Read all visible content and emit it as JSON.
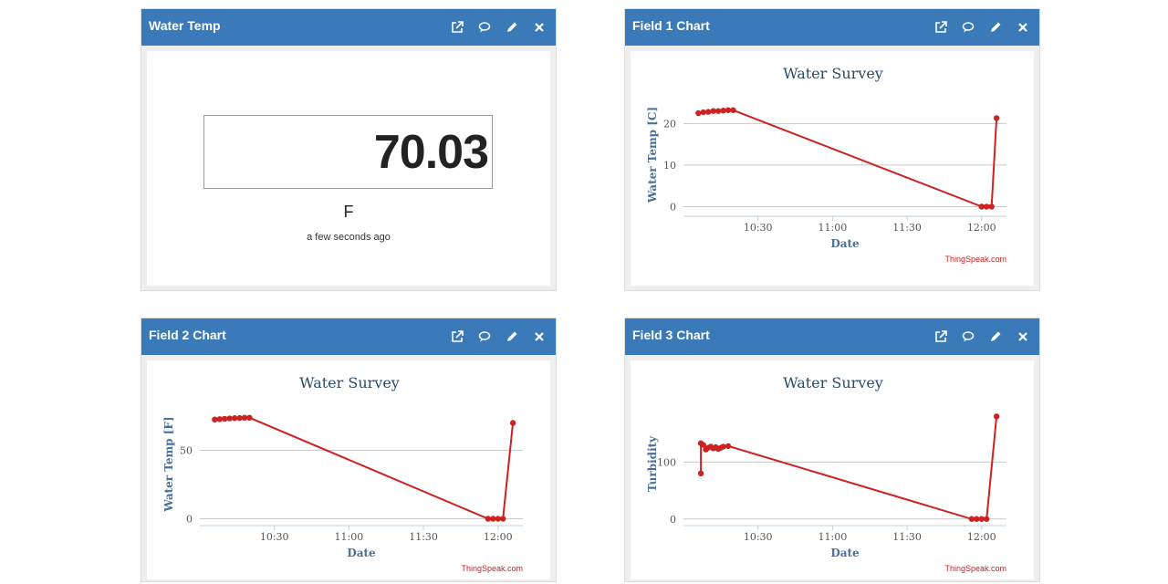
{
  "panels": [
    {
      "title": "Water Temp"
    },
    {
      "title": "Field 1 Chart"
    },
    {
      "title": "Field 2 Chart"
    },
    {
      "title": "Field 3 Chart"
    }
  ],
  "readout": {
    "value": "70.03",
    "unit": "F",
    "updated": "a few seconds ago"
  },
  "chart_credit": "ThingSpeak.com",
  "colors": {
    "header": "#3a7ab8",
    "series": "#cc2222",
    "title": "#2b4a6a",
    "axis_title": "#4a6f98"
  },
  "icons": [
    "external-link-icon",
    "comment-icon",
    "pencil-icon",
    "close-icon"
  ],
  "chart_data": [
    {
      "type": "line",
      "title": "Water Survey",
      "xlabel": "Date",
      "ylabel": "Water Temp [C]",
      "x_ticks": [
        "10:30",
        "11:00",
        "11:30",
        "12:00"
      ],
      "y_ticks": [
        0,
        10,
        20
      ],
      "ylim": [
        -1,
        26
      ],
      "series": [
        {
          "x": [
            "10:06",
            "10:08",
            "10:10",
            "10:12",
            "10:14",
            "10:16",
            "10:18",
            "10:20",
            "12:00",
            "12:02",
            "12:04",
            "12:06"
          ],
          "values": [
            22.5,
            22.7,
            22.8,
            23.0,
            23.0,
            23.1,
            23.2,
            23.2,
            0,
            0,
            0,
            21.3
          ]
        }
      ]
    },
    {
      "type": "line",
      "title": "Water Survey",
      "xlabel": "Date",
      "ylabel": "Water Temp [F]",
      "x_ticks": [
        "10:30",
        "11:00",
        "11:30",
        "12:00"
      ],
      "y_ticks": [
        0,
        50
      ],
      "ylim": [
        -1,
        81
      ],
      "series": [
        {
          "x": [
            "10:06",
            "10:08",
            "10:10",
            "10:12",
            "10:14",
            "10:16",
            "10:18",
            "10:20",
            "11:56",
            "11:58",
            "12:00",
            "12:02",
            "12:06"
          ],
          "values": [
            72.5,
            72.8,
            73.0,
            73.3,
            73.5,
            73.6,
            73.8,
            73.8,
            0,
            0,
            0,
            0,
            70
          ]
        }
      ]
    },
    {
      "type": "line",
      "title": "Water Survey",
      "xlabel": "Date",
      "ylabel": "Turbidity",
      "x_ticks": [
        "10:30",
        "11:00",
        "11:30",
        "12:00"
      ],
      "y_ticks": [
        0,
        100
      ],
      "ylim": [
        -2,
        195
      ],
      "series": [
        {
          "x": [
            "10:07",
            "10:07",
            "10:08",
            "10:09",
            "10:10",
            "10:11",
            "10:12",
            "10:13",
            "10:14",
            "10:15",
            "10:16",
            "10:18",
            "11:56",
            "11:58",
            "12:00",
            "12:02",
            "12:06"
          ],
          "values": [
            80,
            133,
            130,
            122,
            125,
            127,
            124,
            126,
            123,
            125,
            127,
            128,
            0,
            0,
            0,
            0,
            180
          ]
        }
      ]
    }
  ]
}
